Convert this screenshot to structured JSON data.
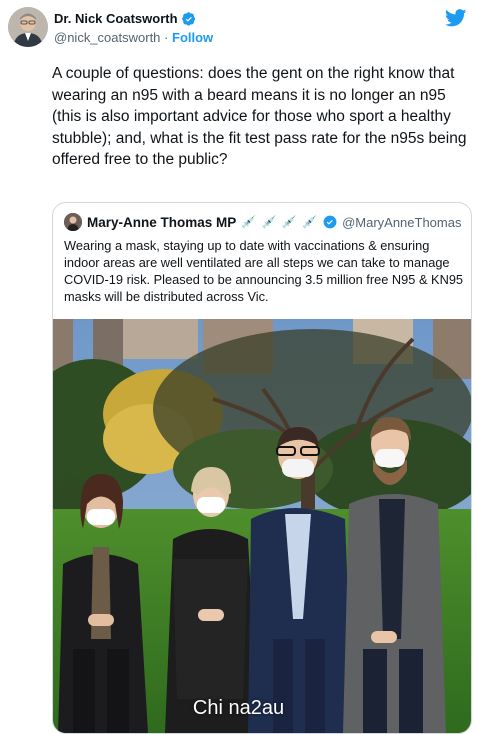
{
  "author": {
    "name": "Dr. Nick Coatsworth",
    "handle": "@nick_coatsworth",
    "separator": "·",
    "follow_label": "Follow",
    "avatar_icon": "person-avatar-icon",
    "verified_icon": "verified-badge-icon"
  },
  "tweet": {
    "text": "A couple of questions: does the gent on the right know that wearing an n95 with a beard means it is no longer an n95 (this is also important advice for those who sport a healthy stubble); and, what is the fit test pass rate for the n95s being offered free to the public?"
  },
  "quote": {
    "name": "Mary-Anne Thomas MP",
    "emojis": "💉 💉 💉 💉",
    "handle": "@MaryAnneThomas",
    "text": "Wearing a mask, staying up to date with vaccinations & ensuring indoor areas are well ventilated are all steps we can take to manage COVID-19 risk. Pleased to be announcing 3.5 million free N95 & KN95 masks will be distributed across Vic.",
    "photo_icon": "press-photo-four-people-masks"
  },
  "watermark": "Chi na2au",
  "colors": {
    "accent": "#1d9bf0",
    "text": "#0f1419",
    "secondary": "#536471",
    "border": "#cfd9de"
  }
}
